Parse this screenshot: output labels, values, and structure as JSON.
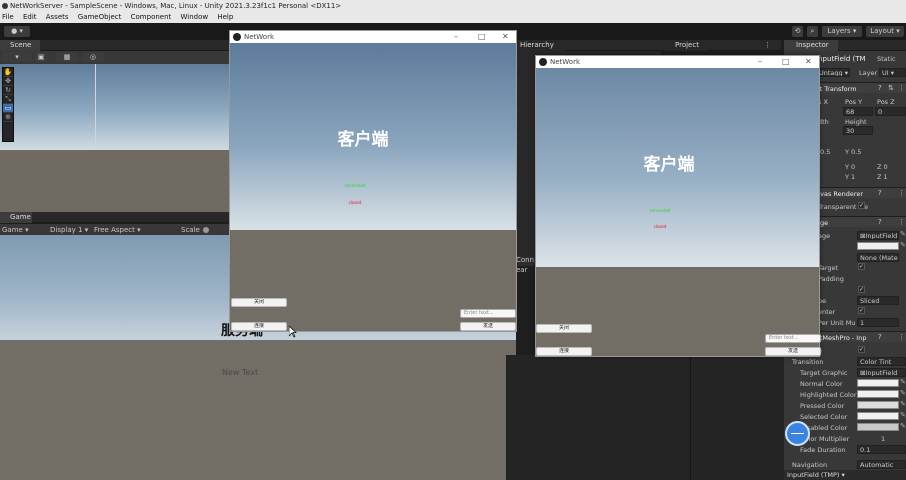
{
  "window_title": "NetWorkServer - SampleScene - Windows, Mac, Linux - Unity 2021.3.23f1c1 Personal <DX11>",
  "menu": [
    "File",
    "Edit",
    "Assets",
    "GameObject",
    "Component",
    "Window",
    "Help"
  ],
  "toolbar": {
    "layers": "Layers",
    "layout": "Layout"
  },
  "scene_panel": {
    "tab": "Scene"
  },
  "game_panel": {
    "tab": "Game",
    "display": "Display 1",
    "aspect": "Free Aspect",
    "scale": "Scale",
    "server_title_fragment": "服务端",
    "new_text": "New Text"
  },
  "hierarchy_tab": "Hierarchy",
  "project_tab": "Project",
  "inspector": {
    "tab": "Inspector",
    "object_name": "InputField (TM",
    "static": "Static",
    "tag": "Untagg",
    "layer_label": "Layer",
    "layer_value": "UI",
    "rect_transform": "ct Transform",
    "pos_x": "s X",
    "pos_y_label": "Pos Y",
    "pos_z_label": "Pos Z",
    "pos_y": "68",
    "pos_z": "0",
    "width_label": "dth",
    "height_label": "Height",
    "height": "30",
    "pivot_x": "0.5",
    "pivot_y": "Y 0.5",
    "rot_y": "Y 0",
    "rot_z": "Z 0",
    "scale_y": "Y 1",
    "scale_z": "Z 1",
    "canvas_renderer": "nvas Renderer",
    "cull": "Transparent Me",
    "image": "age",
    "source_image_label": "age",
    "source_image": "InputField",
    "material": "None (Mater",
    "raycast_target": "Target",
    "raycast_padding": "Padding",
    "image_type_label": "pe",
    "image_type": "Sliced",
    "fill_center": "enter",
    "ppu_label": "Per Unit Mu",
    "ppu": "1",
    "tmp_component": "xtMeshPro - Inp",
    "interactable": "e",
    "transition_label": "Transition",
    "transition": "Color Tint",
    "target_graphic_label": "Target Graphic",
    "target_graphic": "InputField",
    "normal_color": "Normal Color",
    "highlighted_color": "Highlighted Color",
    "pressed_color": "Pressed Color",
    "selected_color": "Selected Color",
    "disabled_color": "Disabled Color",
    "color_multiplier_label": "Color Multiplier",
    "color_multiplier": "1",
    "fade_duration_label": "Fade Duration",
    "fade_duration": "0.1",
    "navigation_label": "Navigation",
    "navigation": "Automatic",
    "footer": "InputField (TMP) ▾"
  },
  "console_fragment": {
    "tab": "Conn",
    "clear": "ear"
  },
  "client_window_1": {
    "title": "NetWork",
    "heading": "客户端",
    "status_green": "connected",
    "status_red": "closed",
    "close_button": "关闭",
    "connect_button": "连接",
    "input_placeholder": "Enter text...",
    "send_button": "发送"
  },
  "client_window_2": {
    "title": "NetWork",
    "heading": "客户端",
    "status_green": "connected",
    "status_red": "closed",
    "close_button": "关闭",
    "connect_button": "连接",
    "input_placeholder": "Enter text...",
    "send_button": "发送"
  },
  "colors": {
    "unity_dark": "#1e1e1e",
    "sky_top": "#5f7e9c",
    "ground": "#726e66",
    "accent_blue": "#3b6ea8"
  }
}
